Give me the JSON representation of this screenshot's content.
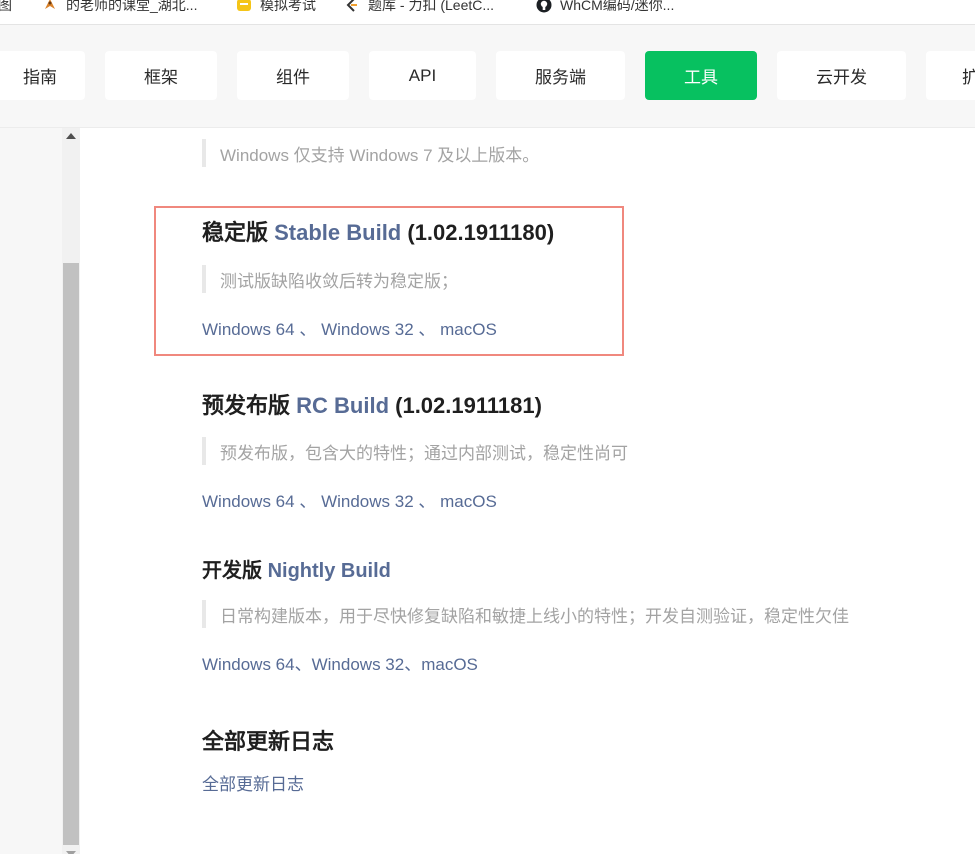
{
  "bookmarks": [
    {
      "label": "地图",
      "icon": "map-icon"
    },
    {
      "label": "的老师的课堂_湖北...",
      "icon": "bird-logo-icon"
    },
    {
      "label": "模拟考试",
      "icon": "exam-icon"
    },
    {
      "label": "题库 - 力扣 (LeetC...",
      "icon": "leetcode-icon"
    },
    {
      "label": "WhCM编码/迷你...",
      "icon": "github-icon"
    }
  ],
  "nav": {
    "tabs": [
      {
        "label": "指南",
        "active": false
      },
      {
        "label": "框架",
        "active": false
      },
      {
        "label": "组件",
        "active": false
      },
      {
        "label": "API",
        "active": false
      },
      {
        "label": "服务端",
        "active": false
      },
      {
        "label": "工具",
        "active": true
      },
      {
        "label": "云开发",
        "active": false
      },
      {
        "label": "扩",
        "active": false
      }
    ],
    "active_color": "#07c160"
  },
  "content": {
    "top_note": "Windows 仅支持 Windows 7 及以上版本。",
    "stable": {
      "prefix": "稳定版 ",
      "name": "Stable Build",
      "version": " (1.02.1911180)",
      "desc": "测试版缺陷收敛后转为稳定版；",
      "win64": "Windows 64",
      "sep1": " 、 ",
      "win32": "Windows 32",
      "sep2": " 、 ",
      "mac": "macOS"
    },
    "rc": {
      "prefix": "预发布版 ",
      "name": "RC Build",
      "version": " (1.02.1911181)",
      "desc": "预发布版，包含大的特性；通过内部测试，稳定性尚可",
      "win64": "Windows 64",
      "sep1": " 、 ",
      "win32": "Windows 32",
      "sep2": " 、 ",
      "mac": "macOS"
    },
    "nightly": {
      "prefix": "开发版 ",
      "name": "Nightly Build",
      "desc": "日常构建版本，用于尽快修复缺陷和敏捷上线小的特性；开发自测验证，稳定性欠佳",
      "win64": "Windows 64",
      "sep1": "、",
      "win32": "Windows 32",
      "sep2": "、",
      "mac": "macOS"
    },
    "changelog": {
      "heading": "全部更新日志",
      "link": "全部更新日志"
    },
    "link_color": "#576b95",
    "highlight_color": "#f0887e"
  }
}
